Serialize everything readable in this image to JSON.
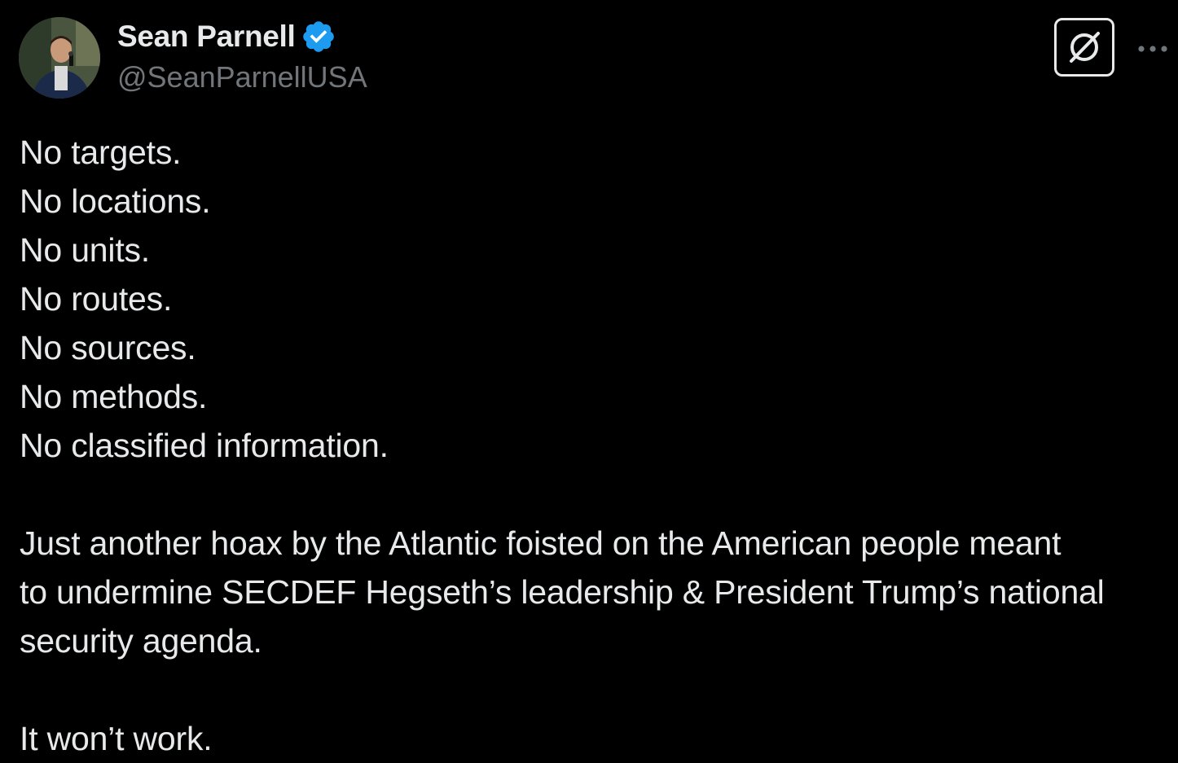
{
  "author": {
    "display_name": "Sean Parnell",
    "handle": "@SeanParnellUSA",
    "verified_icon": "verified-badge-icon",
    "verified_color": "#1d9bf0",
    "avatar_icon": "profile-photo"
  },
  "actions": {
    "grok_icon": "grok-icon",
    "more_icon": "more-horizontal-icon"
  },
  "tweet": {
    "lines": [
      "No targets.",
      "No locations.",
      "No units.",
      "No routes.",
      "No sources.",
      "No methods.",
      "No classified information."
    ],
    "paragraph_lines": [
      "Just another hoax by the Atlantic foisted on the American people meant",
      "to undermine SECDEF Hegseth’s leadership & President Trump’s national",
      "security agenda."
    ],
    "closing": "It won’t work."
  },
  "colors": {
    "background": "#000000",
    "text": "#e7e9ea",
    "secondary_text": "#71767b",
    "accent": "#1d9bf0"
  }
}
